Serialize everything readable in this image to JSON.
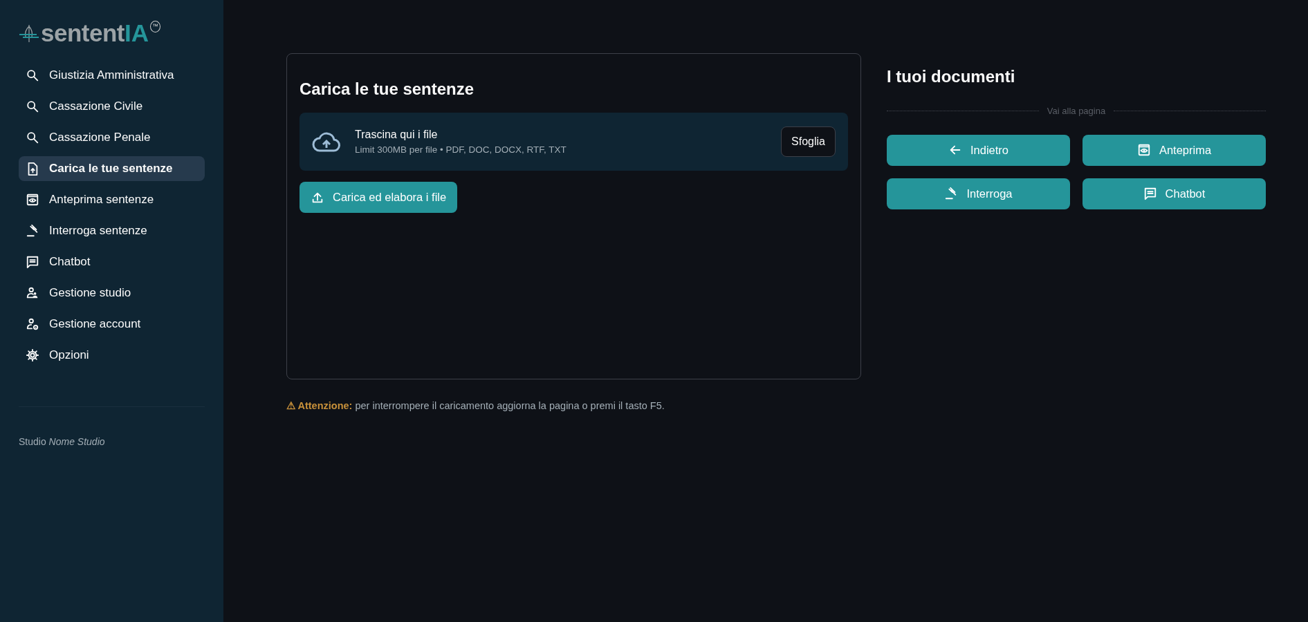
{
  "logo": {
    "text_main": "sentent",
    "text_accent": "IA",
    "mark": "™"
  },
  "sidebar": {
    "items": [
      {
        "label": "Giustizia Amministrativa",
        "kind": "search",
        "selected": false
      },
      {
        "label": "Cassazione Civile",
        "kind": "search",
        "selected": false
      },
      {
        "label": "Cassazione Penale",
        "kind": "search",
        "selected": false
      },
      {
        "label": "Carica le tue sentenze",
        "kind": "upload",
        "selected": true
      },
      {
        "label": "Anteprima sentenze",
        "kind": "preview",
        "selected": false
      },
      {
        "label": "Interroga sentenze",
        "kind": "query",
        "selected": false
      },
      {
        "label": "Chatbot",
        "kind": "chat",
        "selected": false
      },
      {
        "label": "Gestione studio",
        "kind": "studio",
        "selected": false
      },
      {
        "label": "Gestione account",
        "kind": "account",
        "selected": false
      },
      {
        "label": "Opzioni",
        "kind": "options",
        "selected": false
      }
    ],
    "footer": "Studio *Nome Studio*"
  },
  "upload_panel": {
    "title": "Carica le tue sentenze",
    "dropzone": {
      "title": "Trascina qui i file",
      "hint": "Limit 300MB per file • PDF, DOC, DOCX, RTF, TXT",
      "browse_button": "Sfoglia"
    },
    "submit_button": "Carica ed elabora i file"
  },
  "warning": "**⚠ Attenzione:** per interrompere il caricamento aggiorna la pagina o premi il tasto F5.",
  "documents": {
    "title": "I tuoi documenti",
    "divider_label": "Vai alla pagina",
    "buttons": [
      {
        "label": "Indietro",
        "kind": "back"
      },
      {
        "label": "Anteprima",
        "kind": "preview"
      },
      {
        "label": "Interroga",
        "kind": "query"
      },
      {
        "label": "Chatbot",
        "kind": "chat"
      }
    ]
  }
}
